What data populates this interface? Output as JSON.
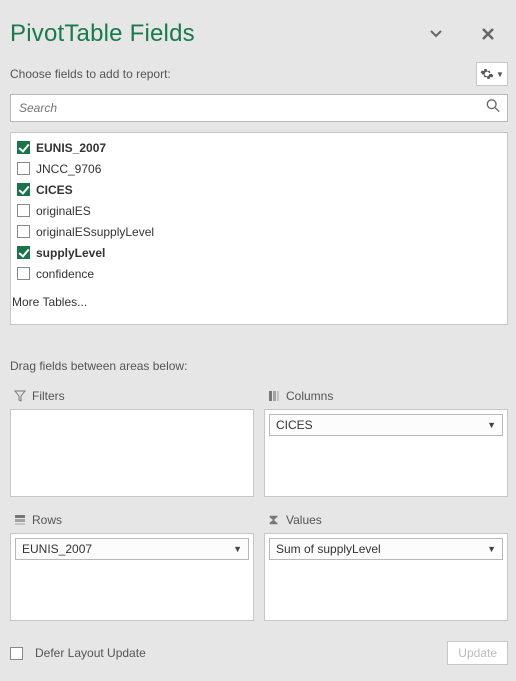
{
  "title": "PivotTable Fields",
  "choose_label": "Choose fields to add to report:",
  "search_placeholder": "Search",
  "fields": [
    {
      "label": "EUNIS_2007",
      "checked": true
    },
    {
      "label": "JNCC_9706",
      "checked": false
    },
    {
      "label": "CICES",
      "checked": true
    },
    {
      "label": "originalES",
      "checked": false
    },
    {
      "label": "originalESsupplyLevel",
      "checked": false
    },
    {
      "label": "supplyLevel",
      "checked": true
    },
    {
      "label": "confidence",
      "checked": false
    }
  ],
  "more_tables": "More Tables...",
  "drag_label": "Drag fields between areas below:",
  "areas": {
    "filters": {
      "title": "Filters",
      "items": []
    },
    "columns": {
      "title": "Columns",
      "items": [
        "CICES"
      ]
    },
    "rows": {
      "title": "Rows",
      "items": [
        "EUNIS_2007"
      ]
    },
    "values": {
      "title": "Values",
      "items": [
        "Sum of supplyLevel"
      ]
    }
  },
  "defer_label": "Defer Layout Update",
  "update_label": "Update"
}
